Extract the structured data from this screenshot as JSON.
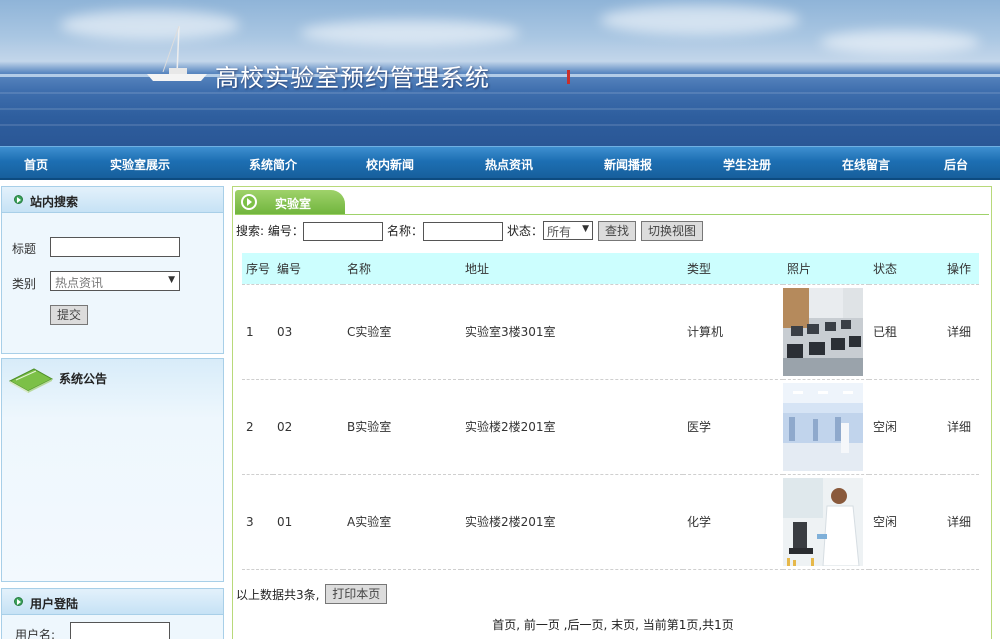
{
  "site": {
    "title": "高校实验室预约管理系统"
  },
  "nav": {
    "items": [
      "首页",
      "实验室展示",
      "系统简介",
      "校内新闻",
      "热点资讯",
      "新闻播报",
      "学生注册",
      "在线留言",
      "后台"
    ]
  },
  "search_box": {
    "heading": "站内搜索",
    "title_label": "标题",
    "category_label": "类别",
    "category_value": "热点资讯",
    "submit_label": "提交"
  },
  "notice": {
    "heading": "系统公告"
  },
  "login": {
    "heading": "用户登陆",
    "username_label": "用户名:"
  },
  "main": {
    "tab_label": "实验室",
    "search_prefix": "搜索: 编号：",
    "name_label": "名称：",
    "status_label": "状态：",
    "status_value": "所有",
    "find_button": "查找",
    "switch_button": "切换视图",
    "columns": [
      "序号",
      "编号",
      "名称",
      "地址",
      "类型",
      "照片",
      "状态",
      "操作"
    ],
    "rows": [
      {
        "idx": "1",
        "code": "03",
        "name": "C实验室",
        "address": "实验室3楼301室",
        "type": "计算机",
        "photo": "computer-lab-photo",
        "status": "已租",
        "action": "详细"
      },
      {
        "idx": "2",
        "code": "02",
        "name": "B实验室",
        "address": "实验楼2楼201室",
        "type": "医学",
        "photo": "medical-lab-photo",
        "status": "空闲",
        "action": "详细"
      },
      {
        "idx": "3",
        "code": "01",
        "name": "A实验室",
        "address": "实验楼2楼201室",
        "type": "化学",
        "photo": "chemistry-lab-photo",
        "status": "空闲",
        "action": "详细"
      }
    ],
    "summary_text": "以上数据共3条,",
    "print_button": "打印本页",
    "pager_text": "首页, 前一页 ,后一页, 末页, 当前第1页,共1页"
  }
}
